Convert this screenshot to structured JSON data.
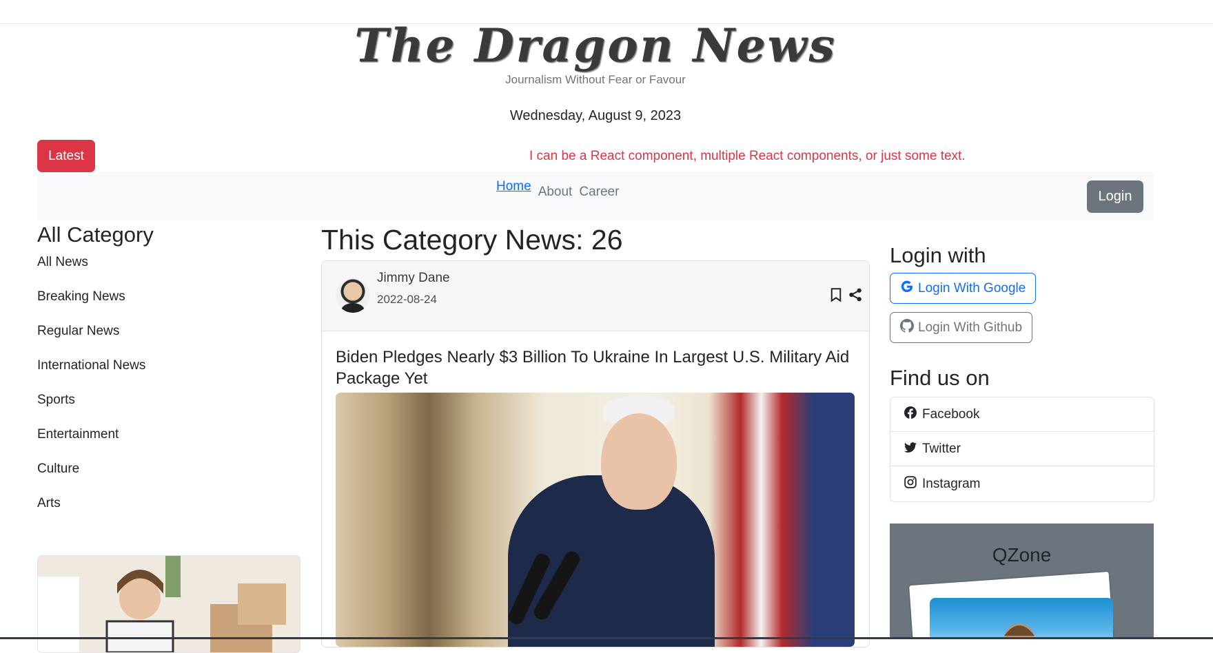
{
  "header": {
    "logo_text": "The Dragon News",
    "tagline": "Journalism Without Fear or Favour",
    "date": "Wednesday, August 9, 2023"
  },
  "ticker": {
    "latest_label": "Latest",
    "marquee_text": "I can be a React component, multiple React components, or just some text."
  },
  "nav": {
    "links": [
      {
        "label": "Home",
        "active": true
      },
      {
        "label": "About",
        "active": false
      },
      {
        "label": "Career",
        "active": false
      }
    ],
    "login_label": "Login"
  },
  "left": {
    "title": "All Category",
    "categories": [
      "All News",
      "Breaking News",
      "Regular News",
      "International News",
      "Sports",
      "Entertainment",
      "Culture",
      "Arts"
    ]
  },
  "main": {
    "title": "This Category News: 26",
    "article": {
      "author": "Jimmy Dane",
      "date": "2022-08-24",
      "headline": "Biden Pledges Nearly $3 Billion To Ukraine In Largest U.S. Military Aid Package Yet"
    }
  },
  "right": {
    "login_title": "Login with",
    "google_label": "Login With Google",
    "github_label": "Login With Github",
    "find_title": "Find us on",
    "socials": [
      {
        "label": "Facebook",
        "icon": "facebook-icon"
      },
      {
        "label": "Twitter",
        "icon": "twitter-icon"
      },
      {
        "label": "Instagram",
        "icon": "instagram-icon"
      }
    ],
    "qzone_title": "QZone"
  },
  "colors": {
    "danger": "#dc3545",
    "primary": "#0d6efd",
    "secondary": "#6c757d",
    "navbar_bg": "#f8f9fa"
  }
}
